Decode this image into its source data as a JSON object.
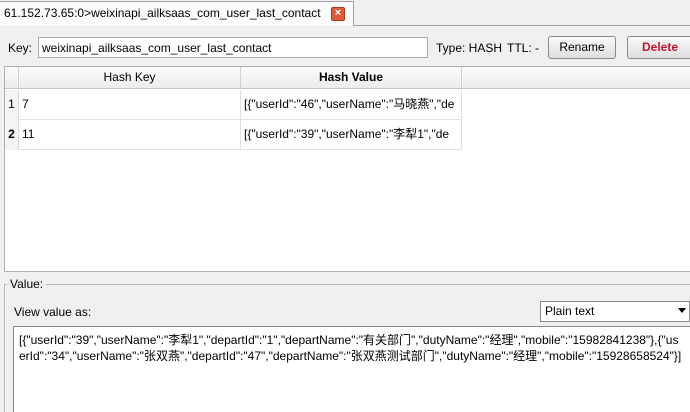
{
  "tab": {
    "title": "61.152.73.65:0>weixinapi_ailksaas_com_user_last_contact",
    "close_icon": "×"
  },
  "key_row": {
    "key_label": "Key:",
    "key_value": "weixinapi_ailksaas_com_user_last_contact",
    "type_label": "Type: HASH",
    "ttl_label": "TTL: -",
    "rename_label": "Rename",
    "delete_label": "Delete"
  },
  "table": {
    "headers": {
      "key": "Hash Key",
      "value": "Hash Value"
    },
    "rows": [
      {
        "num": "1",
        "key": "7",
        "value": "[{\"userId\":\"46\",\"userName\":\"马晓燕\",\"de"
      },
      {
        "num": "2",
        "key": "11",
        "value": "[{\"userId\":\"39\",\"userName\":\"李犁1\",\"de"
      }
    ]
  },
  "value_panel": {
    "group_label": "Value:",
    "view_as_label": "View value as:",
    "view_as_selected": "Plain text",
    "text": "[{\"userId\":\"39\",\"userName\":\"李犁1\",\"departId\":\"1\",\"departName\":\"有关部门\",\"dutyName\":\"经理\",\"mobile\":\"15982841238\"},{\"userId\":\"34\",\"userName\":\"张双燕\",\"departId\":\"47\",\"departName\":\"张双燕测试部门\",\"dutyName\":\"经理\",\"mobile\":\"15928658524\"}]"
  }
}
